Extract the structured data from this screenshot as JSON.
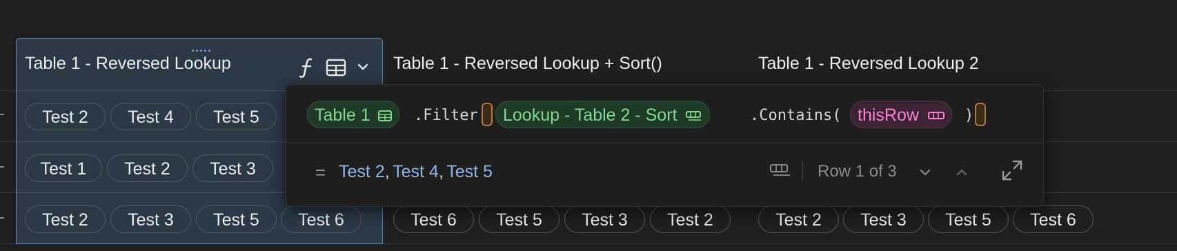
{
  "columns": [
    {
      "title": "Table 1 - Reversed Lookup"
    },
    {
      "title": "Table 1 - Reversed Lookup + Sort()"
    },
    {
      "title": "Table 1 - Reversed Lookup 2"
    }
  ],
  "rows": {
    "col1": [
      [
        "Test 2",
        "Test 4",
        "Test 5"
      ],
      [
        "Test 1",
        "Test 2",
        "Test 3"
      ],
      [
        "Test 2",
        "Test 3",
        "Test 5",
        "Test 6"
      ]
    ],
    "col2_row3": [
      "Test 6",
      "Test 5",
      "Test 3",
      "Test 2"
    ],
    "col3_row3": [
      "Test 2",
      "Test 3",
      "Test 5",
      "Test 6"
    ]
  },
  "header_icons": {
    "formula": "formula-icon",
    "table": "table-icon",
    "chevron": "chevron-down-icon"
  },
  "formula": {
    "table_token": "Table 1",
    "filter_fn": ".Filter",
    "lookup_token": "Lookup - Table 2 - Sort",
    "contains_fn": ".Contains(",
    "row_token": "thisRow",
    "close_paren": ")"
  },
  "result": {
    "eq": "=",
    "values": [
      "Test 2",
      "Test 4",
      "Test 5"
    ],
    "separator": ",",
    "row_indicator": "Row 1 of 3"
  },
  "colors": {
    "background": "#1f1f1f",
    "selected_column": "#2b3846",
    "selected_border": "#5f88b3",
    "table_token": "#7fd98f",
    "row_token": "#ff7fd2",
    "result_link": "#8fb8e8"
  }
}
